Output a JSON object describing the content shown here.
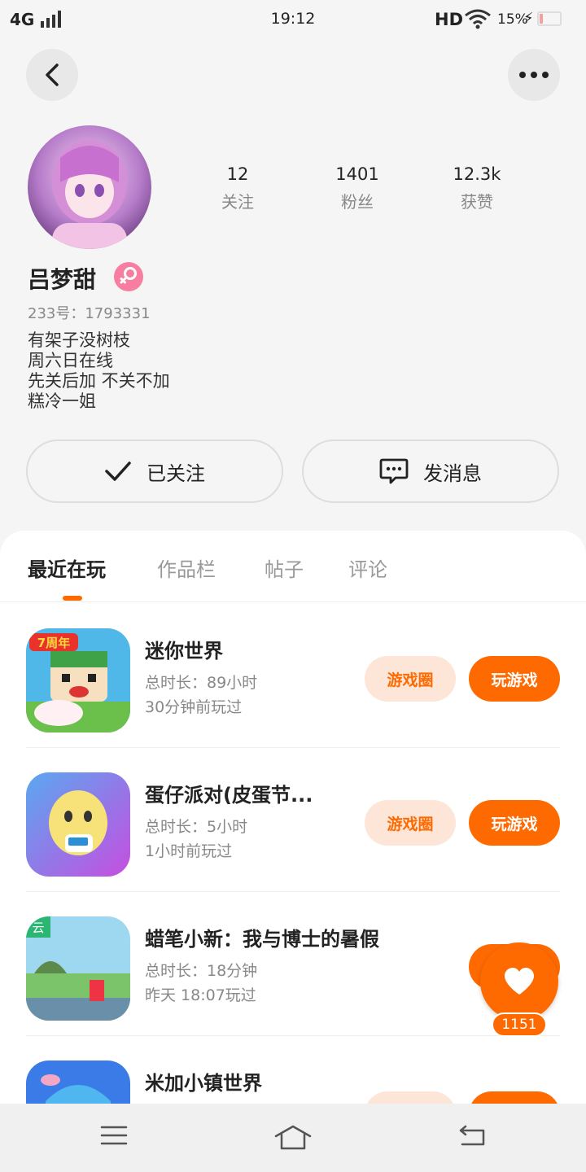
{
  "status_bar": {
    "network": "4G",
    "time": "19:12",
    "hd": "HD",
    "battery": "15%"
  },
  "profile": {
    "name": "吕梦甜",
    "uid_label": "233号：",
    "uid": "1793331",
    "bio": [
      "有架子没树枝",
      "周六日在线",
      "先关后加 不关不加",
      "糕冷一姐"
    ],
    "stats": [
      {
        "value": "12",
        "label": "关注"
      },
      {
        "value": "1401",
        "label": "粉丝"
      },
      {
        "value": "12.3k",
        "label": "获赞"
      }
    ]
  },
  "actions": {
    "follow_label": "已关注",
    "message_label": "发消息"
  },
  "tabs": [
    {
      "label": "最近在玩",
      "active": true
    },
    {
      "label": "作品栏",
      "active": false
    },
    {
      "label": "帖子",
      "active": false
    },
    {
      "label": "评论",
      "active": false
    }
  ],
  "games": [
    {
      "title": "迷你世界",
      "duration": "总时长：89小时",
      "last_played": "30分钟前玩过"
    },
    {
      "title": "蛋仔派对(皮蛋节...",
      "duration": "总时长：5小时",
      "last_played": "1小时前玩过"
    },
    {
      "title": "蜡笔小新：我与博士的暑假",
      "duration": "总时长：18分钟",
      "last_played": "昨天 18:07玩过"
    },
    {
      "title": "米加小镇世界",
      "duration": "",
      "last_played": ""
    }
  ],
  "game_buttons": {
    "circle": "游戏圈",
    "play": "玩游戏"
  },
  "icon_labels": {
    "game1_badge": "7周年",
    "game3_badge": "云"
  },
  "like_float": {
    "count": "1151"
  },
  "colors": {
    "accent": "#ff6a00",
    "accent_light": "#fde6d8",
    "gender": "#f77ea1"
  }
}
